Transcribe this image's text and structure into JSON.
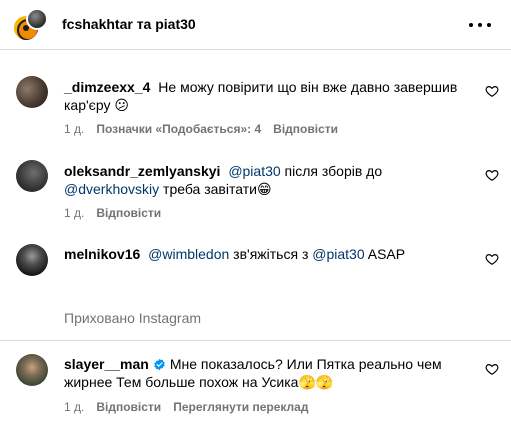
{
  "header": {
    "title": "fcshakhtar та piat30"
  },
  "comments": [
    {
      "username": "_dimzeexx_4",
      "text": "Не можу повірити що він вже давно завершив кар'єру 😕",
      "time": "1 д.",
      "likes": "Позначки «Подобається»: 4",
      "reply": "Відповісти"
    },
    {
      "username": "oleksandr_zemlyanskyi",
      "mention1": "@piat30",
      "text_mid": " після зборів до ",
      "mention2": "@dverkhovskiy",
      "text_end": " треба завітати😁",
      "time": "1 д.",
      "reply": "Відповісти"
    },
    {
      "username": "melnikov16",
      "mention1": "@wimbledon",
      "text_mid": " зв'яжіться з ",
      "mention2": "@piat30",
      "text_end": " ASAP",
      "time": "1 д.",
      "reply": "Відповісти"
    },
    {
      "username": "slayer__man",
      "text": "Мне показалось? Или Пятка реально чем жирнее Тем больше похож на Усика🫣🫣",
      "time": "1 д.",
      "reply": "Відповісти",
      "translate": "Переглянути переклад"
    }
  ],
  "hidden_notice": "Приховано Instagram",
  "colors": {
    "meta_gray": "#737373",
    "mention_blue": "#00376b",
    "verified_blue": "#0095f6",
    "divider": "#dbdbdb"
  }
}
